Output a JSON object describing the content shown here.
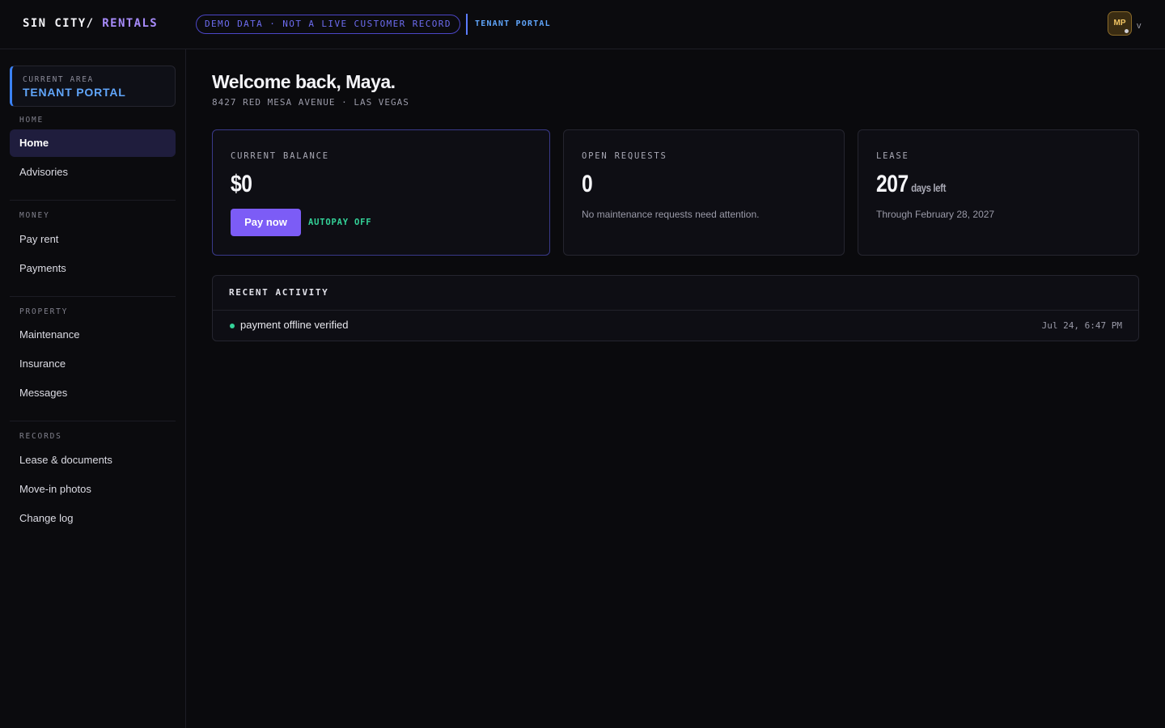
{
  "header": {
    "logo_part1": "SIN CITY/",
    "logo_part2": " RENTALS",
    "demo_badge": "DEMO DATA · NOT A LIVE CUSTOMER RECORD",
    "portal_tag": "TENANT PORTAL",
    "avatar_initials": "MP",
    "avatar_caret": "v"
  },
  "sidebar": {
    "area_label": "CURRENT AREA",
    "area_name": "TENANT PORTAL",
    "sections": [
      {
        "label": "HOME",
        "items": [
          "Home",
          "Advisories"
        ]
      },
      {
        "label": "MONEY",
        "items": [
          "Pay rent",
          "Payments"
        ]
      },
      {
        "label": "PROPERTY",
        "items": [
          "Maintenance",
          "Insurance",
          "Messages"
        ]
      },
      {
        "label": "RECORDS",
        "items": [
          "Lease & documents",
          "Move-in photos",
          "Change log"
        ]
      }
    ],
    "active_item": "Home"
  },
  "main": {
    "greeting": "Welcome back, Maya.",
    "address": "8427 RED MESA AVENUE · LAS VEGAS",
    "balance": {
      "label": "CURRENT BALANCE",
      "value": "$0",
      "pay_button": "Pay now",
      "autopay": "AUTOPAY OFF"
    },
    "requests": {
      "label": "OPEN REQUESTS",
      "value": "0",
      "sub": "No maintenance requests need attention."
    },
    "lease": {
      "label": "LEASE",
      "value": "207",
      "unit": "days left",
      "sub": "Through February 28, 2027"
    },
    "activity": {
      "title": "RECENT ACTIVITY",
      "items": [
        {
          "text": "payment offline verified",
          "time": "Jul 24, 6:47 PM"
        }
      ]
    }
  },
  "colors": {
    "accent_purple": "#7c5cf6",
    "accent_blue": "#60a5fa",
    "success_green": "#34d399",
    "background": "#0a0a0d"
  }
}
